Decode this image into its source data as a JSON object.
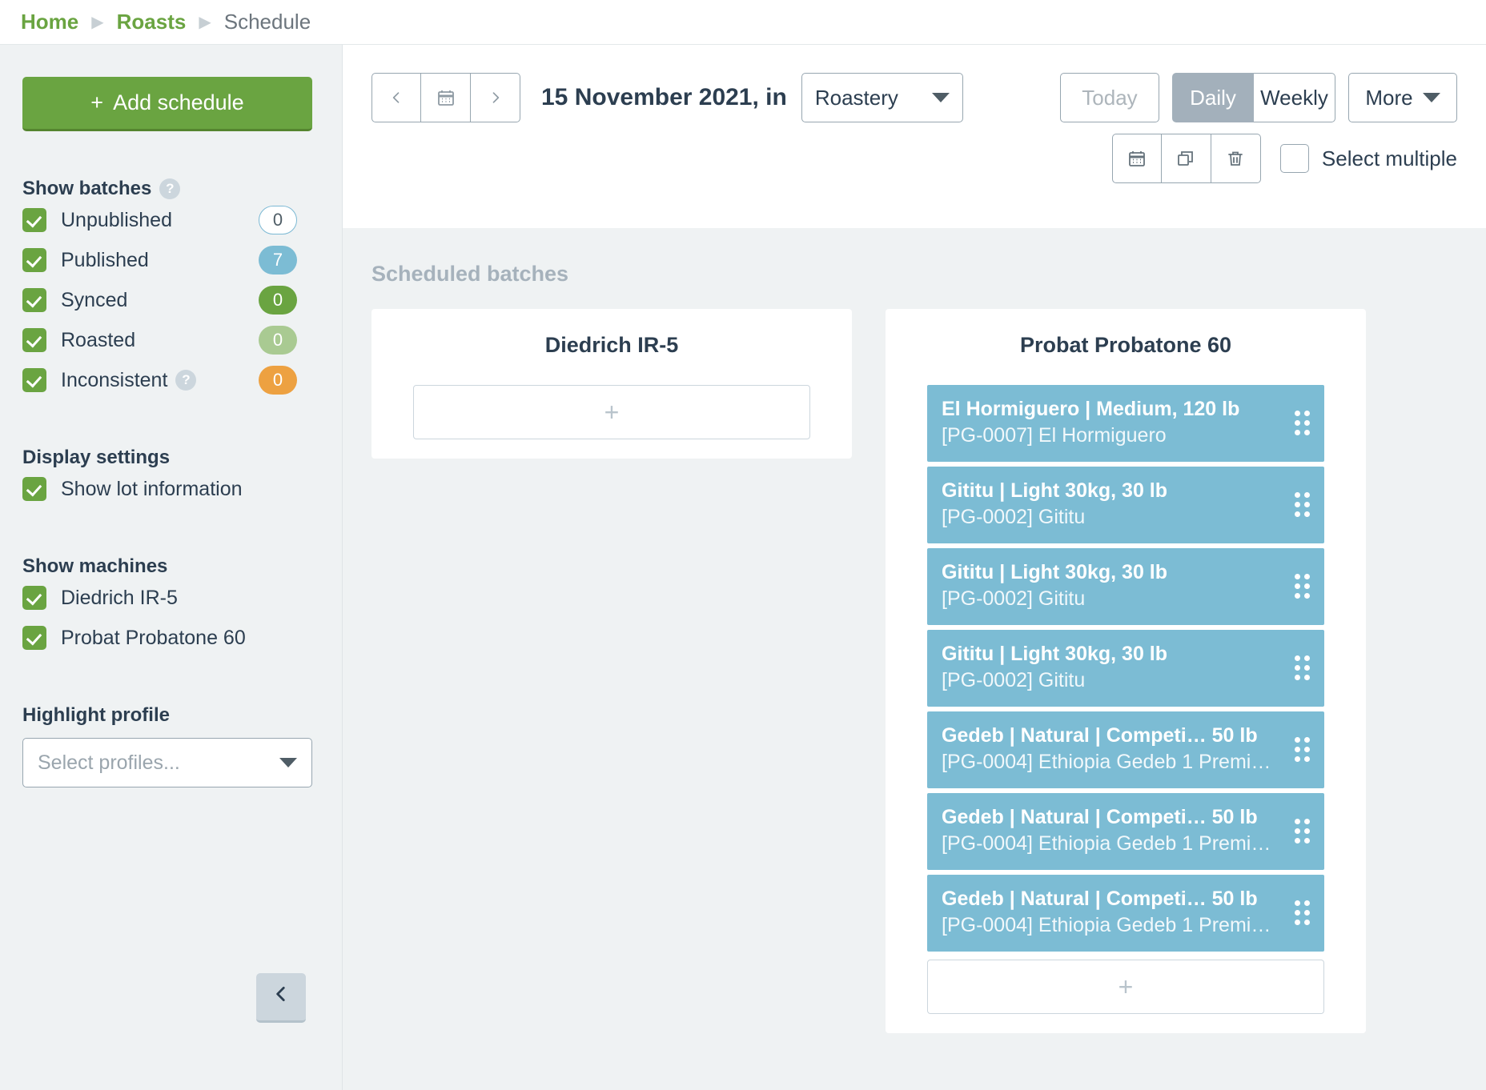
{
  "breadcrumb": {
    "items": [
      {
        "label": "Home",
        "current": false
      },
      {
        "label": "Roasts",
        "current": false
      },
      {
        "label": "Schedule",
        "current": true
      }
    ],
    "separator": "▶"
  },
  "sidebar": {
    "add_schedule_label": "Add schedule",
    "add_schedule_plus": "+",
    "show_batches": {
      "heading": "Show batches",
      "help_glyph": "?",
      "items": [
        {
          "label": "Unpublished",
          "count": "0",
          "style": "outline",
          "checked": true,
          "help": false
        },
        {
          "label": "Published",
          "count": "7",
          "style": "blue",
          "checked": true,
          "help": false
        },
        {
          "label": "Synced",
          "count": "0",
          "style": "green",
          "checked": true,
          "help": false
        },
        {
          "label": "Roasted",
          "count": "0",
          "style": "lgreen",
          "checked": true,
          "help": false
        },
        {
          "label": "Inconsistent",
          "count": "0",
          "style": "orange",
          "checked": true,
          "help": true
        }
      ]
    },
    "display_settings": {
      "heading": "Display settings",
      "items": [
        {
          "label": "Show lot information",
          "checked": true
        }
      ]
    },
    "show_machines": {
      "heading": "Show machines",
      "items": [
        {
          "label": "Diedrich IR-5",
          "checked": true
        },
        {
          "label": "Probat Probatone 60",
          "checked": true
        }
      ]
    },
    "highlight_profile": {
      "heading": "Highlight profile",
      "placeholder": "Select profiles...",
      "value": ""
    },
    "collapse_glyph": "‹"
  },
  "toolbar": {
    "prev_glyph": "‹",
    "calendar_glyph": "▦",
    "next_glyph": "›",
    "date_title": "15 November 2021, in",
    "location": {
      "value": "Roastery"
    },
    "today_label": "Today",
    "daily_label": "Daily",
    "weekly_label": "Weekly",
    "active_view": "Daily",
    "more_label": "More",
    "action_calendar_glyph": "▦",
    "action_copy_glyph": "⧉",
    "action_delete_glyph": "Ὕ1",
    "select_multiple_label": "Select multiple",
    "select_multiple_checked": false
  },
  "board": {
    "title": "Scheduled batches",
    "add_glyph": "+",
    "columns": [
      {
        "machine": "Diedrich IR-5",
        "batches": []
      },
      {
        "machine": "Probat Probatone 60",
        "batches": [
          {
            "title": "El Hormiguero | Medium, 120 lb",
            "subtitle": "[PG-0007] El Hormiguero"
          },
          {
            "title": "Gititu | Light 30kg, 30 lb",
            "subtitle": "[PG-0002] Gititu"
          },
          {
            "title": "Gititu | Light 30kg, 30 lb",
            "subtitle": "[PG-0002] Gititu"
          },
          {
            "title": "Gititu | Light 30kg, 30 lb",
            "subtitle": "[PG-0002] Gititu"
          },
          {
            "title": "Gedeb | Natural | Competi… 50 lb",
            "subtitle": "[PG-0004] Ethiopia Gedeb 1 Premi…"
          },
          {
            "title": "Gedeb | Natural | Competi… 50 lb",
            "subtitle": "[PG-0004] Ethiopia Gedeb 1 Premi…"
          },
          {
            "title": "Gedeb | Natural | Competi… 50 lb",
            "subtitle": "[PG-0004] Ethiopia Gedeb 1 Premi…"
          }
        ]
      }
    ]
  },
  "colors": {
    "brand_green": "#6aa441",
    "batch_blue": "#7cbcd4",
    "accent_orange": "#eda141",
    "panel_bg": "#eff2f3"
  }
}
